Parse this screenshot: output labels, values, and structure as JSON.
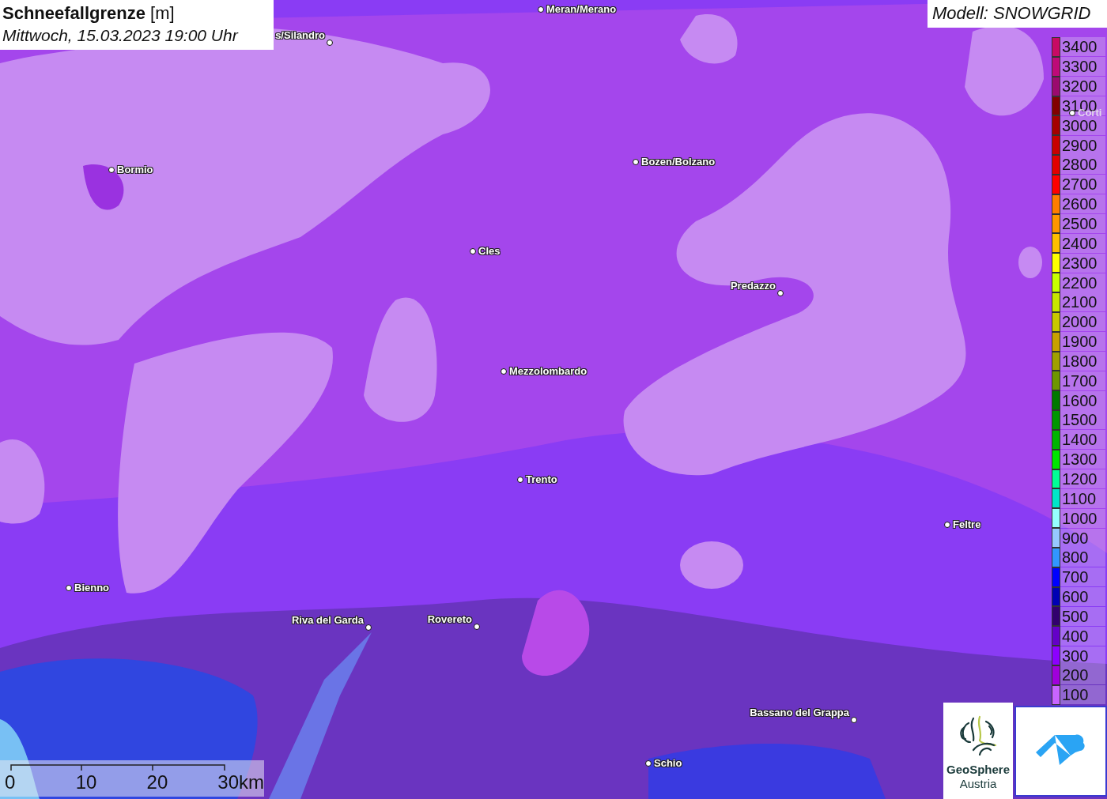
{
  "title": {
    "parameter": "Schneefallgrenze",
    "unit": "[m]",
    "datetime": "Mittwoch, 15.03.2023 19:00 Uhr"
  },
  "model": "Modell: SNOWGRID",
  "places": [
    {
      "name": "Meran/Merano"
    },
    {
      "name": "s/Silandro"
    },
    {
      "name": "Bormio"
    },
    {
      "name": "Bozen/Bolzano"
    },
    {
      "name": "Cles"
    },
    {
      "name": "Predazzo"
    },
    {
      "name": "Mezzolombardo"
    },
    {
      "name": "Trento"
    },
    {
      "name": "Feltre"
    },
    {
      "name": "Bienno"
    },
    {
      "name": "Riva del Garda"
    },
    {
      "name": "Rovereto"
    },
    {
      "name": "Bassano del Grappa"
    },
    {
      "name": "Schio"
    },
    {
      "name": "Corti"
    }
  ],
  "legend": [
    {
      "label": "3400",
      "color": "#c80a64"
    },
    {
      "label": "3300",
      "color": "#be0a78"
    },
    {
      "label": "3200",
      "color": "#9b0a6e"
    },
    {
      "label": "3100",
      "color": "#820000"
    },
    {
      "label": "3000",
      "color": "#a50000"
    },
    {
      "label": "2900",
      "color": "#c80000"
    },
    {
      "label": "2800",
      "color": "#e10000"
    },
    {
      "label": "2700",
      "color": "#ff0000"
    },
    {
      "label": "2600",
      "color": "#ff7d00"
    },
    {
      "label": "2500",
      "color": "#ff9600"
    },
    {
      "label": "2400",
      "color": "#ffbe00"
    },
    {
      "label": "2300",
      "color": "#ffff00"
    },
    {
      "label": "2200",
      "color": "#c8ff00"
    },
    {
      "label": "2100",
      "color": "#c8e600"
    },
    {
      "label": "2000",
      "color": "#c8c800"
    },
    {
      "label": "1900",
      "color": "#c8a000"
    },
    {
      "label": "1800",
      "color": "#a0a000"
    },
    {
      "label": "1700",
      "color": "#6e9600"
    },
    {
      "label": "1600",
      "color": "#007800"
    },
    {
      "label": "1500",
      "color": "#009600"
    },
    {
      "label": "1400",
      "color": "#00b400"
    },
    {
      "label": "1300",
      "color": "#00e600"
    },
    {
      "label": "1200",
      "color": "#00ff96"
    },
    {
      "label": "1100",
      "color": "#00e6c8"
    },
    {
      "label": "1000",
      "color": "#96ffff"
    },
    {
      "label": "900",
      "color": "#96c8ff"
    },
    {
      "label": "800",
      "color": "#3296ff"
    },
    {
      "label": "700",
      "color": "#0000ff"
    },
    {
      "label": "600",
      "color": "#0000b4"
    },
    {
      "label": "500",
      "color": "#32006e"
    },
    {
      "label": "400",
      "color": "#6400c8"
    },
    {
      "label": "300",
      "color": "#8c00ff"
    },
    {
      "label": "200",
      "color": "#a000dc"
    },
    {
      "label": "100",
      "color": "#c864ff"
    }
  ],
  "scale": [
    "0",
    "10",
    "20",
    "30km"
  ],
  "logo": {
    "line1": "GeoSphere",
    "line2": "Austria"
  }
}
